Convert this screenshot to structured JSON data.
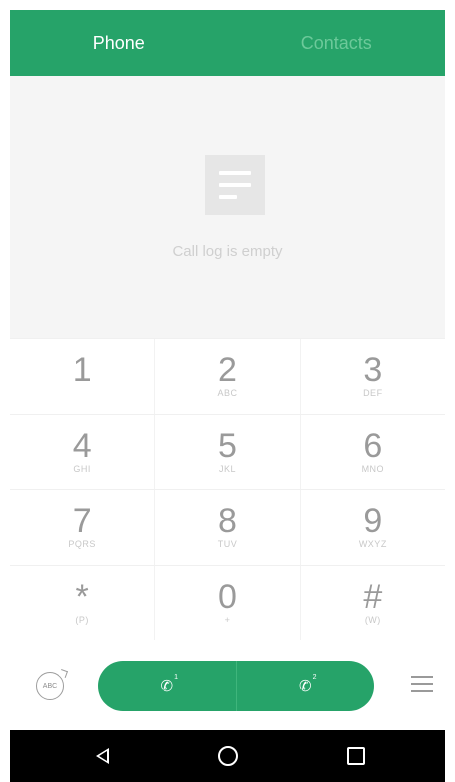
{
  "tabs": [
    {
      "label": "Phone",
      "active": true
    },
    {
      "label": "Contacts",
      "active": false
    }
  ],
  "call_log": {
    "empty_text": "Call log is empty"
  },
  "keypad": {
    "rows": [
      [
        {
          "digit": "1",
          "letters": ""
        },
        {
          "digit": "2",
          "letters": "ABC"
        },
        {
          "digit": "3",
          "letters": "DEF"
        }
      ],
      [
        {
          "digit": "4",
          "letters": "GHI"
        },
        {
          "digit": "5",
          "letters": "JKL"
        },
        {
          "digit": "6",
          "letters": "MNO"
        }
      ],
      [
        {
          "digit": "7",
          "letters": "PQRS"
        },
        {
          "digit": "8",
          "letters": "TUV"
        },
        {
          "digit": "9",
          "letters": "WXYZ"
        }
      ],
      [
        {
          "digit": "*",
          "letters": "(P)"
        },
        {
          "digit": "0",
          "letters": "+"
        },
        {
          "digit": "#",
          "letters": "(W)"
        }
      ]
    ]
  },
  "bottom_bar": {
    "abc_label": "ABC",
    "call_sim1_badge": "1",
    "call_sim2_badge": "2"
  },
  "colors": {
    "accent": "#26a369",
    "navbar": "#000000"
  },
  "icons": {
    "abc": "abc-toggle-icon",
    "call1": "phone-sim1-icon",
    "call2": "phone-sim2-icon",
    "menu": "menu-icon",
    "back": "back-icon",
    "home": "home-icon",
    "recents": "recents-icon"
  }
}
